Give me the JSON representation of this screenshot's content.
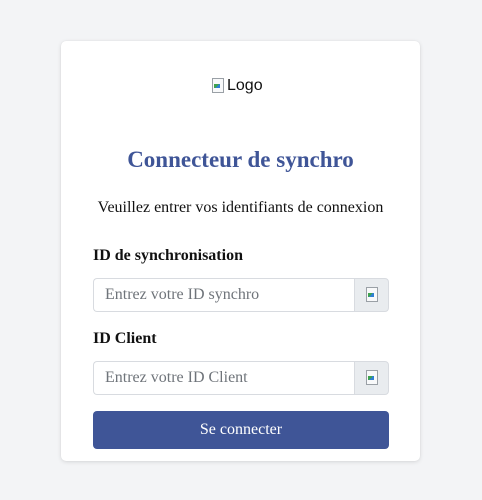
{
  "logo": {
    "alt_text": "Logo"
  },
  "header": {
    "title": "Connecteur de synchro",
    "subtitle": "Veuillez entrer vos identifiants de connexion"
  },
  "form": {
    "sync_id": {
      "label": "ID de synchronisation",
      "value": "",
      "placeholder": "Entrez votre ID synchro"
    },
    "client_id": {
      "label": "ID Client",
      "value": "",
      "placeholder": "Entrez votre ID Client"
    },
    "submit_label": "Se connecter"
  },
  "colors": {
    "accent": "#3f5597",
    "background": "#f3f4f6",
    "card": "#ffffff",
    "addon": "#e9ecef"
  }
}
